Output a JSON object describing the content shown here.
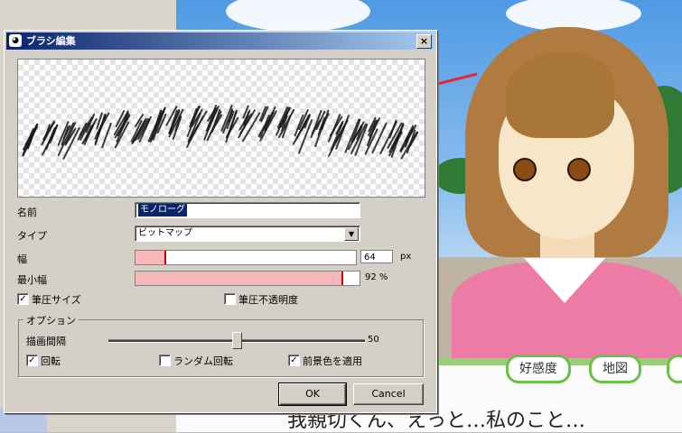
{
  "dialog": {
    "title": "ブラシ編集",
    "close_glyph": "×",
    "name_label": "名前",
    "name_value": "モノローグ",
    "type_label": "タイプ",
    "type_value": "ビットマップ",
    "width_label": "幅",
    "width_value": "64",
    "width_unit": "px",
    "width_fraction": 0.13,
    "min_width_label": "最小幅",
    "min_width_value": "92",
    "min_width_unit": "%",
    "min_width_fraction": 0.92,
    "pressure_size_label": "筆圧サイズ",
    "pressure_size_checked": true,
    "pressure_opacity_label": "筆圧不透明度",
    "pressure_opacity_checked": false,
    "options_title": "オプション",
    "interval_label": "描画間隔",
    "interval_value": "50",
    "interval_fraction": 0.5,
    "rotate_label": "回転",
    "rotate_checked": true,
    "random_rotate_label": "ランダム回転",
    "random_rotate_checked": false,
    "apply_fg_label": "前景色を適用",
    "apply_fg_checked": true,
    "ok_label": "OK",
    "cancel_label": "Cancel"
  },
  "game": {
    "buttons": [
      "好感度",
      "地図"
    ],
    "dialogue": "我親切くん、えっと…私のこと…"
  },
  "colors": {
    "titlebar_start": "#0a246a",
    "slider_fill": "#f6b8b8",
    "slider_marker": "#d80000",
    "annotation_arrow": "#e8233a",
    "menu_border": "#6cc04a"
  }
}
